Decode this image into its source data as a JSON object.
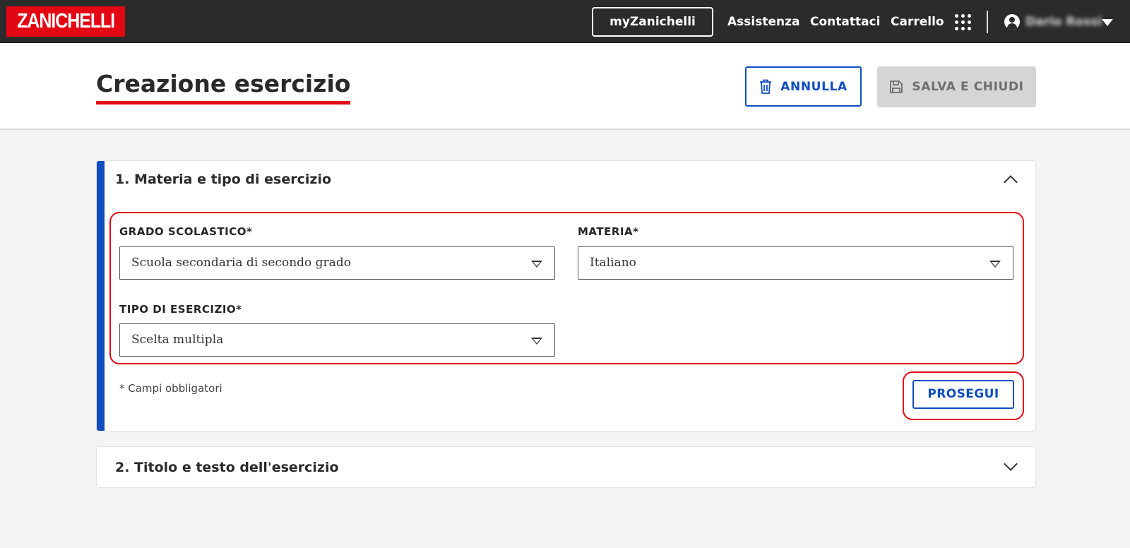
{
  "topbar": {
    "logo": "ZANICHELLI",
    "my_button": "myZanichelli",
    "links": [
      "Assistenza",
      "Contattaci",
      "Carrello"
    ],
    "user_name": "Dario Rossi"
  },
  "header": {
    "title": "Creazione esercizio",
    "cancel_label": "ANNULLA",
    "save_label": "SALVA E CHIUDI"
  },
  "section1": {
    "title": "1. Materia e tipo di esercizio",
    "grado": {
      "label": "GRADO SCOLASTICO*",
      "value": "Scuola secondaria di secondo grado"
    },
    "materia": {
      "label": "MATERIA*",
      "value": "Italiano"
    },
    "tipo": {
      "label": "TIPO DI ESERCIZIO*",
      "value": "Scelta multipla"
    },
    "required_note": "* Campi obbligatori",
    "next_label": "PROSEGUI"
  },
  "section2": {
    "title": "2. Titolo e testo dell'esercizio"
  },
  "colors": {
    "brand_red": "#e30613",
    "accent_blue": "#0f4ebf",
    "topbar_bg": "#2b2b2b"
  }
}
